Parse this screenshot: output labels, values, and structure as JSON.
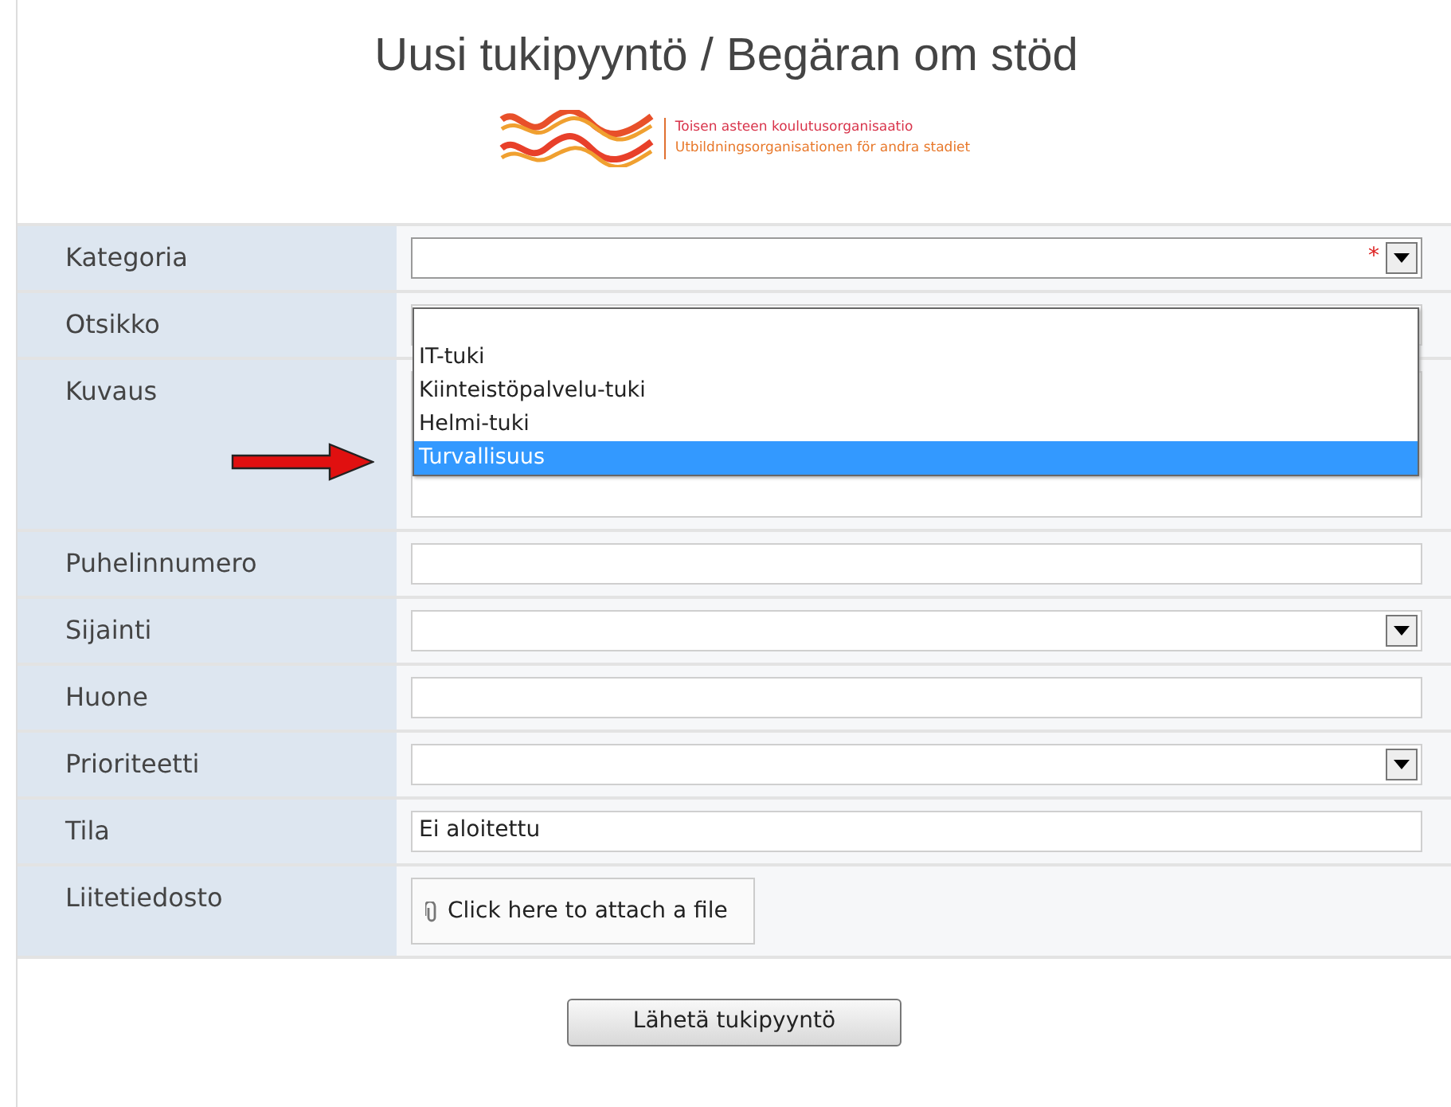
{
  "title": "Uusi tukipyyntö / Begäran om stöd",
  "logo": {
    "line_1": "Toisen asteen koulutusorganisaatio",
    "line_2": "Utbildningsorganisationen för andra stadiet"
  },
  "fields": [
    {
      "label": "Kategoria",
      "kind": "select",
      "required_mark": "*",
      "open": true
    },
    {
      "label": "Otsikko",
      "kind": "text"
    },
    {
      "label": "Kuvaus",
      "kind": "textarea"
    },
    {
      "label": "Puhelinnumero",
      "kind": "text"
    },
    {
      "label": "Sijainti",
      "kind": "select"
    },
    {
      "label": "Huone",
      "kind": "text"
    },
    {
      "label": "Prioriteetti",
      "kind": "select"
    },
    {
      "label": "Tila",
      "kind": "text",
      "value": "Ei aloitettu"
    },
    {
      "label": "Liitetiedosto",
      "kind": "attach",
      "button": "Click here to attach a file"
    }
  ],
  "dropdown_options": [
    {
      "label": "IT-tuki",
      "selected": false
    },
    {
      "label": "Kiinteistöpalvelu-tuki",
      "selected": false
    },
    {
      "label": "Helmi-tuki",
      "selected": false
    },
    {
      "label": "Turvallisuus",
      "selected": true
    }
  ],
  "submit_button": "Lähetä tukipyyntö"
}
